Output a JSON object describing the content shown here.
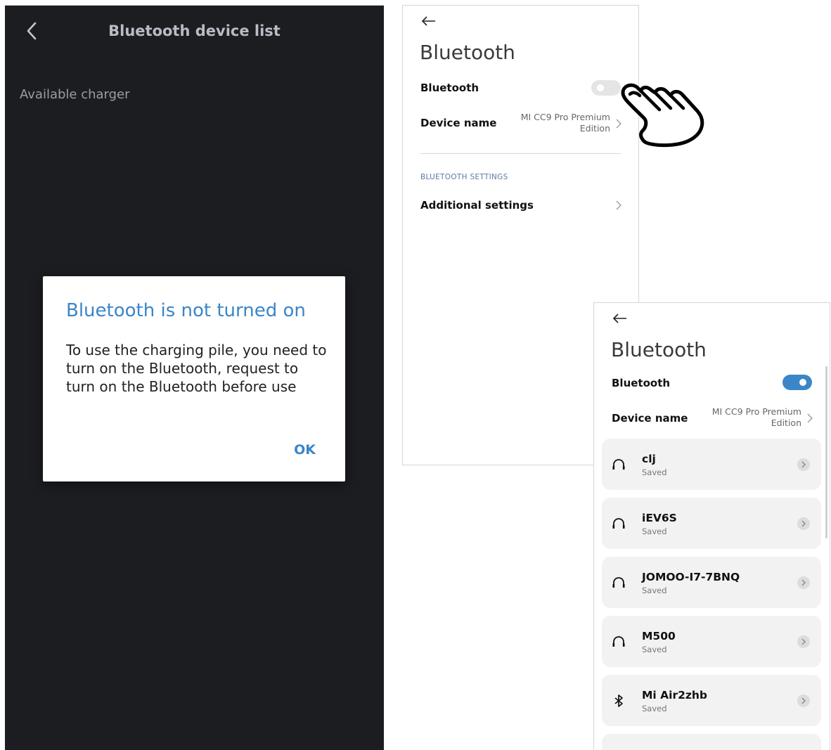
{
  "left_app": {
    "title": "Bluetooth device list",
    "available_label": "Available charger",
    "dialog": {
      "title": "Bluetooth is not turned on",
      "message": "To use the charging pile, you need to turn on the Bluetooth, request to turn on the Bluetooth before use",
      "ok_label": "OK"
    }
  },
  "settings_off": {
    "title": "Bluetooth",
    "bluetooth_label": "Bluetooth",
    "bluetooth_enabled": false,
    "device_name_label": "Device name",
    "device_name_value": "MI CC9 Pro Premium Edition",
    "section_header": "BLUETOOTH SETTINGS",
    "additional_settings_label": "Additional settings"
  },
  "settings_on": {
    "title": "Bluetooth",
    "bluetooth_label": "Bluetooth",
    "bluetooth_enabled": true,
    "device_name_label": "Device name",
    "device_name_value": "MI CC9 Pro Premium Edition",
    "devices": [
      {
        "name": "clj",
        "status": "Saved",
        "icon": "headphones-icon"
      },
      {
        "name": "iEV6S",
        "status": "Saved",
        "icon": "headphones-icon"
      },
      {
        "name": "JOMOO-I7-7BNQ",
        "status": "Saved",
        "icon": "headphones-icon"
      },
      {
        "name": "M500",
        "status": "Saved",
        "icon": "headphones-icon"
      },
      {
        "name": "Mi Air2zhb",
        "status": "Saved",
        "icon": "bluetooth-icon"
      }
    ]
  },
  "colors": {
    "accent_blue": "#3a86c8",
    "toggle_on": "#3a86c8",
    "toggle_off": "#e5e5e5",
    "dark_bg": "#1c1d21"
  },
  "annotation_icon": "pointing-hand-icon"
}
